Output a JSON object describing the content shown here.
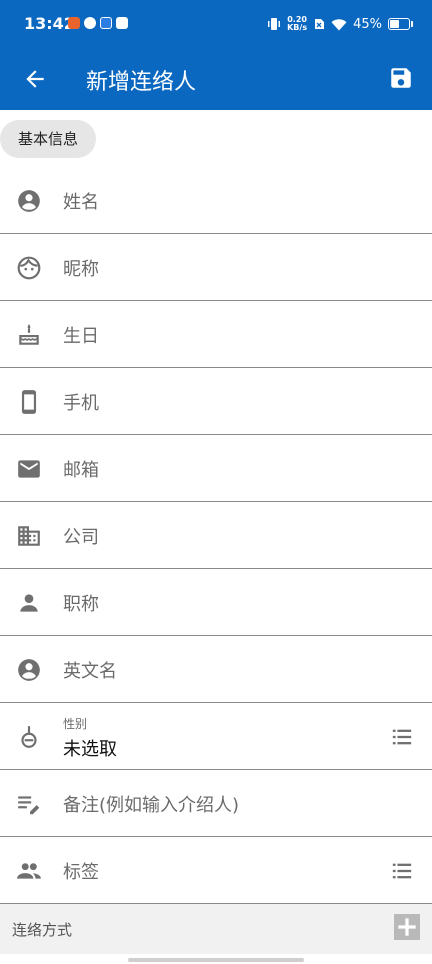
{
  "status_bar": {
    "time": "13:42",
    "net_speed_top": "0.20",
    "net_speed_bottom": "KB/s",
    "battery": "45%",
    "battery_level": 0.45
  },
  "appbar": {
    "title": "新增连络人",
    "back_icon": "arrow-back-icon",
    "save_icon": "save-icon",
    "color": "#0b68c0"
  },
  "section_basic": {
    "label": "基本信息"
  },
  "fields": {
    "name": {
      "label": "姓名",
      "icon": "person-circle-icon"
    },
    "nickname": {
      "label": "昵称",
      "icon": "face-icon"
    },
    "birthday": {
      "label": "生日",
      "icon": "cake-icon"
    },
    "mobile": {
      "label": "手机",
      "icon": "phone-icon"
    },
    "email": {
      "label": "邮箱",
      "icon": "mail-icon"
    },
    "company": {
      "label": "公司",
      "icon": "building-icon"
    },
    "job_title": {
      "label": "职称",
      "icon": "person-icon"
    },
    "english_name": {
      "label": "英文名",
      "icon": "person-circle-icon"
    },
    "gender": {
      "label": "性别",
      "value": "未选取",
      "icon": "gender-icon",
      "trail_icon": "list-icon"
    },
    "note": {
      "label": "备注(例如输入介绍人)",
      "icon": "edit-note-icon"
    },
    "tags": {
      "label": "标签",
      "icon": "people-icon",
      "trail_icon": "list-icon"
    }
  },
  "contact_section": {
    "label": "连络方式",
    "add_icon": "plus-icon"
  }
}
